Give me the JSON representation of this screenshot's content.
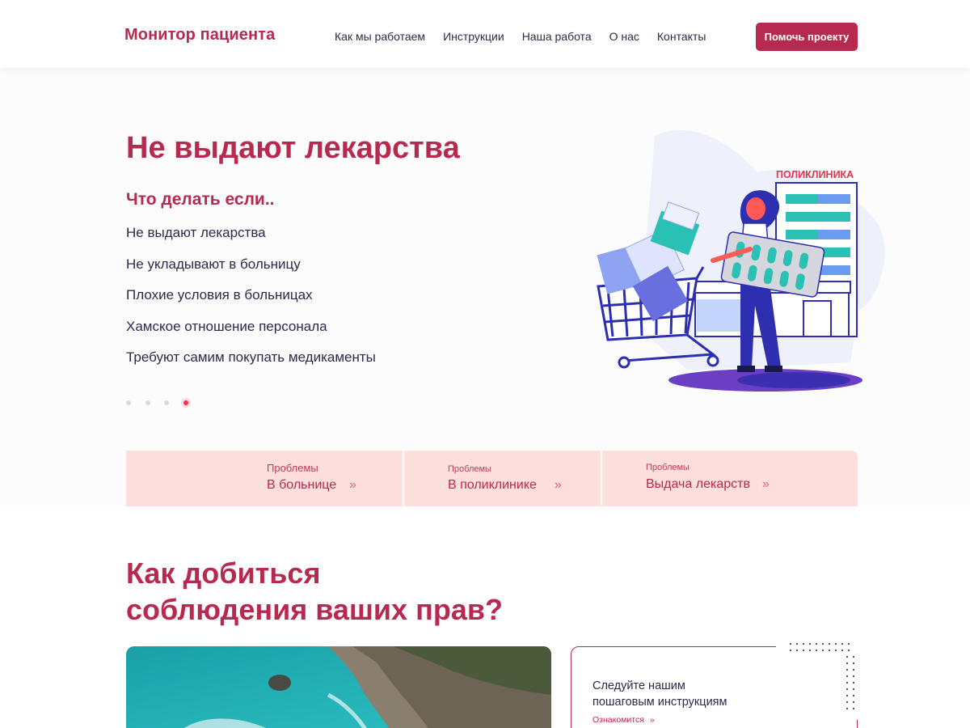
{
  "header": {
    "logo": "Монитор пациента",
    "nav": [
      "Как мы работаем",
      "Инструкции",
      "Наша работа",
      "О нас",
      "Контакты"
    ],
    "cta": "Помочь проекту"
  },
  "hero": {
    "title": "Не выдают лекарства",
    "subtitle": "Что делать если..",
    "items": [
      "Не выдают лекарства",
      "Не укладывают в больницу",
      "Плохие условия в больницах",
      "Хамское отношение персонала",
      "Требуют самим покупать медикаменты"
    ],
    "slider": {
      "count": 4,
      "active_index": 3
    },
    "illustration_sign": "ПОЛИКЛИНИКА"
  },
  "categories": [
    {
      "small": "Проблемы",
      "big": "В больнице",
      "arrow": "»"
    },
    {
      "small": "Проблемы",
      "big": "В поликлинике",
      "arrow": "»"
    },
    {
      "small": "Проблемы",
      "big": "Выдача лекарств",
      "arrow": "»"
    }
  ],
  "rights": {
    "title_line1": "Как добиться",
    "title_line2": "соблюдения ваших прав?",
    "card_line1": "Следуйте нашим",
    "card_line2": "пошаговым инструкциям",
    "card_link": "Ознакомится",
    "card_link_arrow": "»"
  },
  "colors": {
    "brand": "#b8294f",
    "card_bg": "#ffdede",
    "text": "#2c2a4a"
  }
}
